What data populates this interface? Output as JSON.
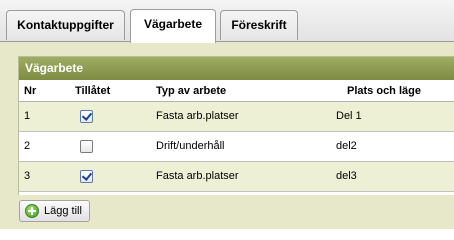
{
  "tabs": [
    {
      "label": "Kontaktuppgifter",
      "active": false
    },
    {
      "label": "Vägarbete",
      "active": true
    },
    {
      "label": "Föreskrift",
      "active": false
    }
  ],
  "panel": {
    "title": "Vägarbete",
    "columns": {
      "nr": "Nr",
      "allowed": "Tillåtet",
      "work_type": "Typ av arbete",
      "location": "Plats och läge"
    },
    "rows": [
      {
        "nr": "1",
        "allowed": true,
        "work_type": "Fasta arb.platser",
        "location": "Del 1",
        "highlighted": true
      },
      {
        "nr": "2",
        "allowed": false,
        "work_type": "Drift/underhåll",
        "location": "del2",
        "highlighted": false
      },
      {
        "nr": "3",
        "allowed": true,
        "work_type": "Fasta arb.platser",
        "location": "del3",
        "highlighted": true
      }
    ]
  },
  "add_button": {
    "label": "Lägg till",
    "icon": "add-icon"
  },
  "colors": {
    "panel_header": "#8a984f",
    "content_background": "#e6e8c9",
    "row_highlight": "#eef0d6"
  }
}
